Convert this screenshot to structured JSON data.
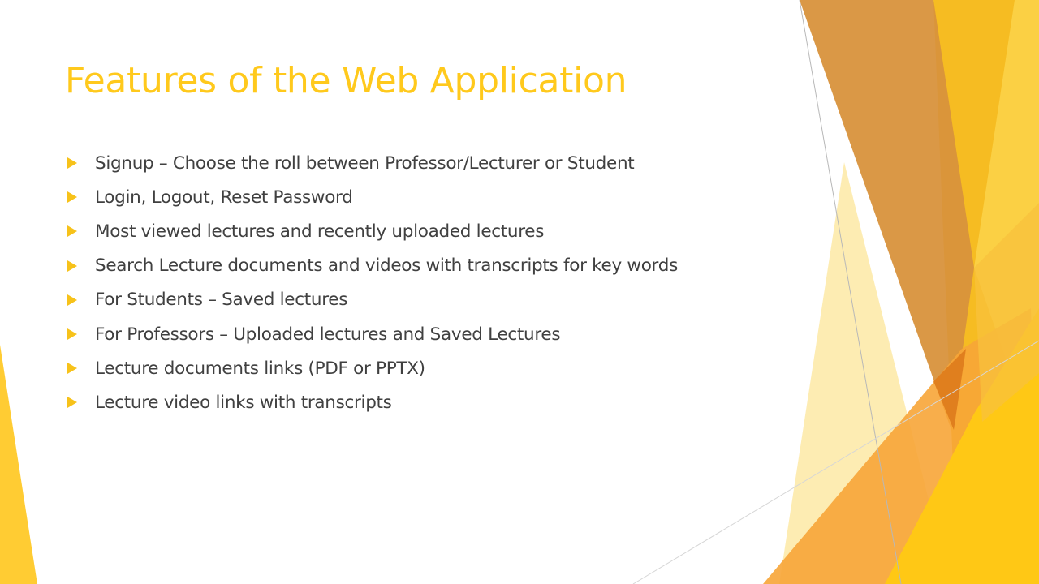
{
  "slide": {
    "title": "Features of the Web Application",
    "bullets": [
      "Signup – Choose the roll between Professor/Lecturer or Student",
      "Login, Logout, Reset Password",
      "Most viewed lectures and recently uploaded lectures",
      "Search Lecture documents and videos with transcripts for key words",
      "For Students – Saved lectures",
      "For Professors – Uploaded lectures and Saved Lectures",
      "Lecture documents links (PDF or PPTX)",
      "Lecture video links with transcripts"
    ]
  },
  "theme": {
    "title_color": "#FFC91C",
    "text_color": "#404040",
    "bullet_color": "#F7C21A",
    "accent_colors": [
      "#FFC91C",
      "#F4A830",
      "#D98A2C",
      "#FDE68A",
      "#F7B731"
    ]
  }
}
